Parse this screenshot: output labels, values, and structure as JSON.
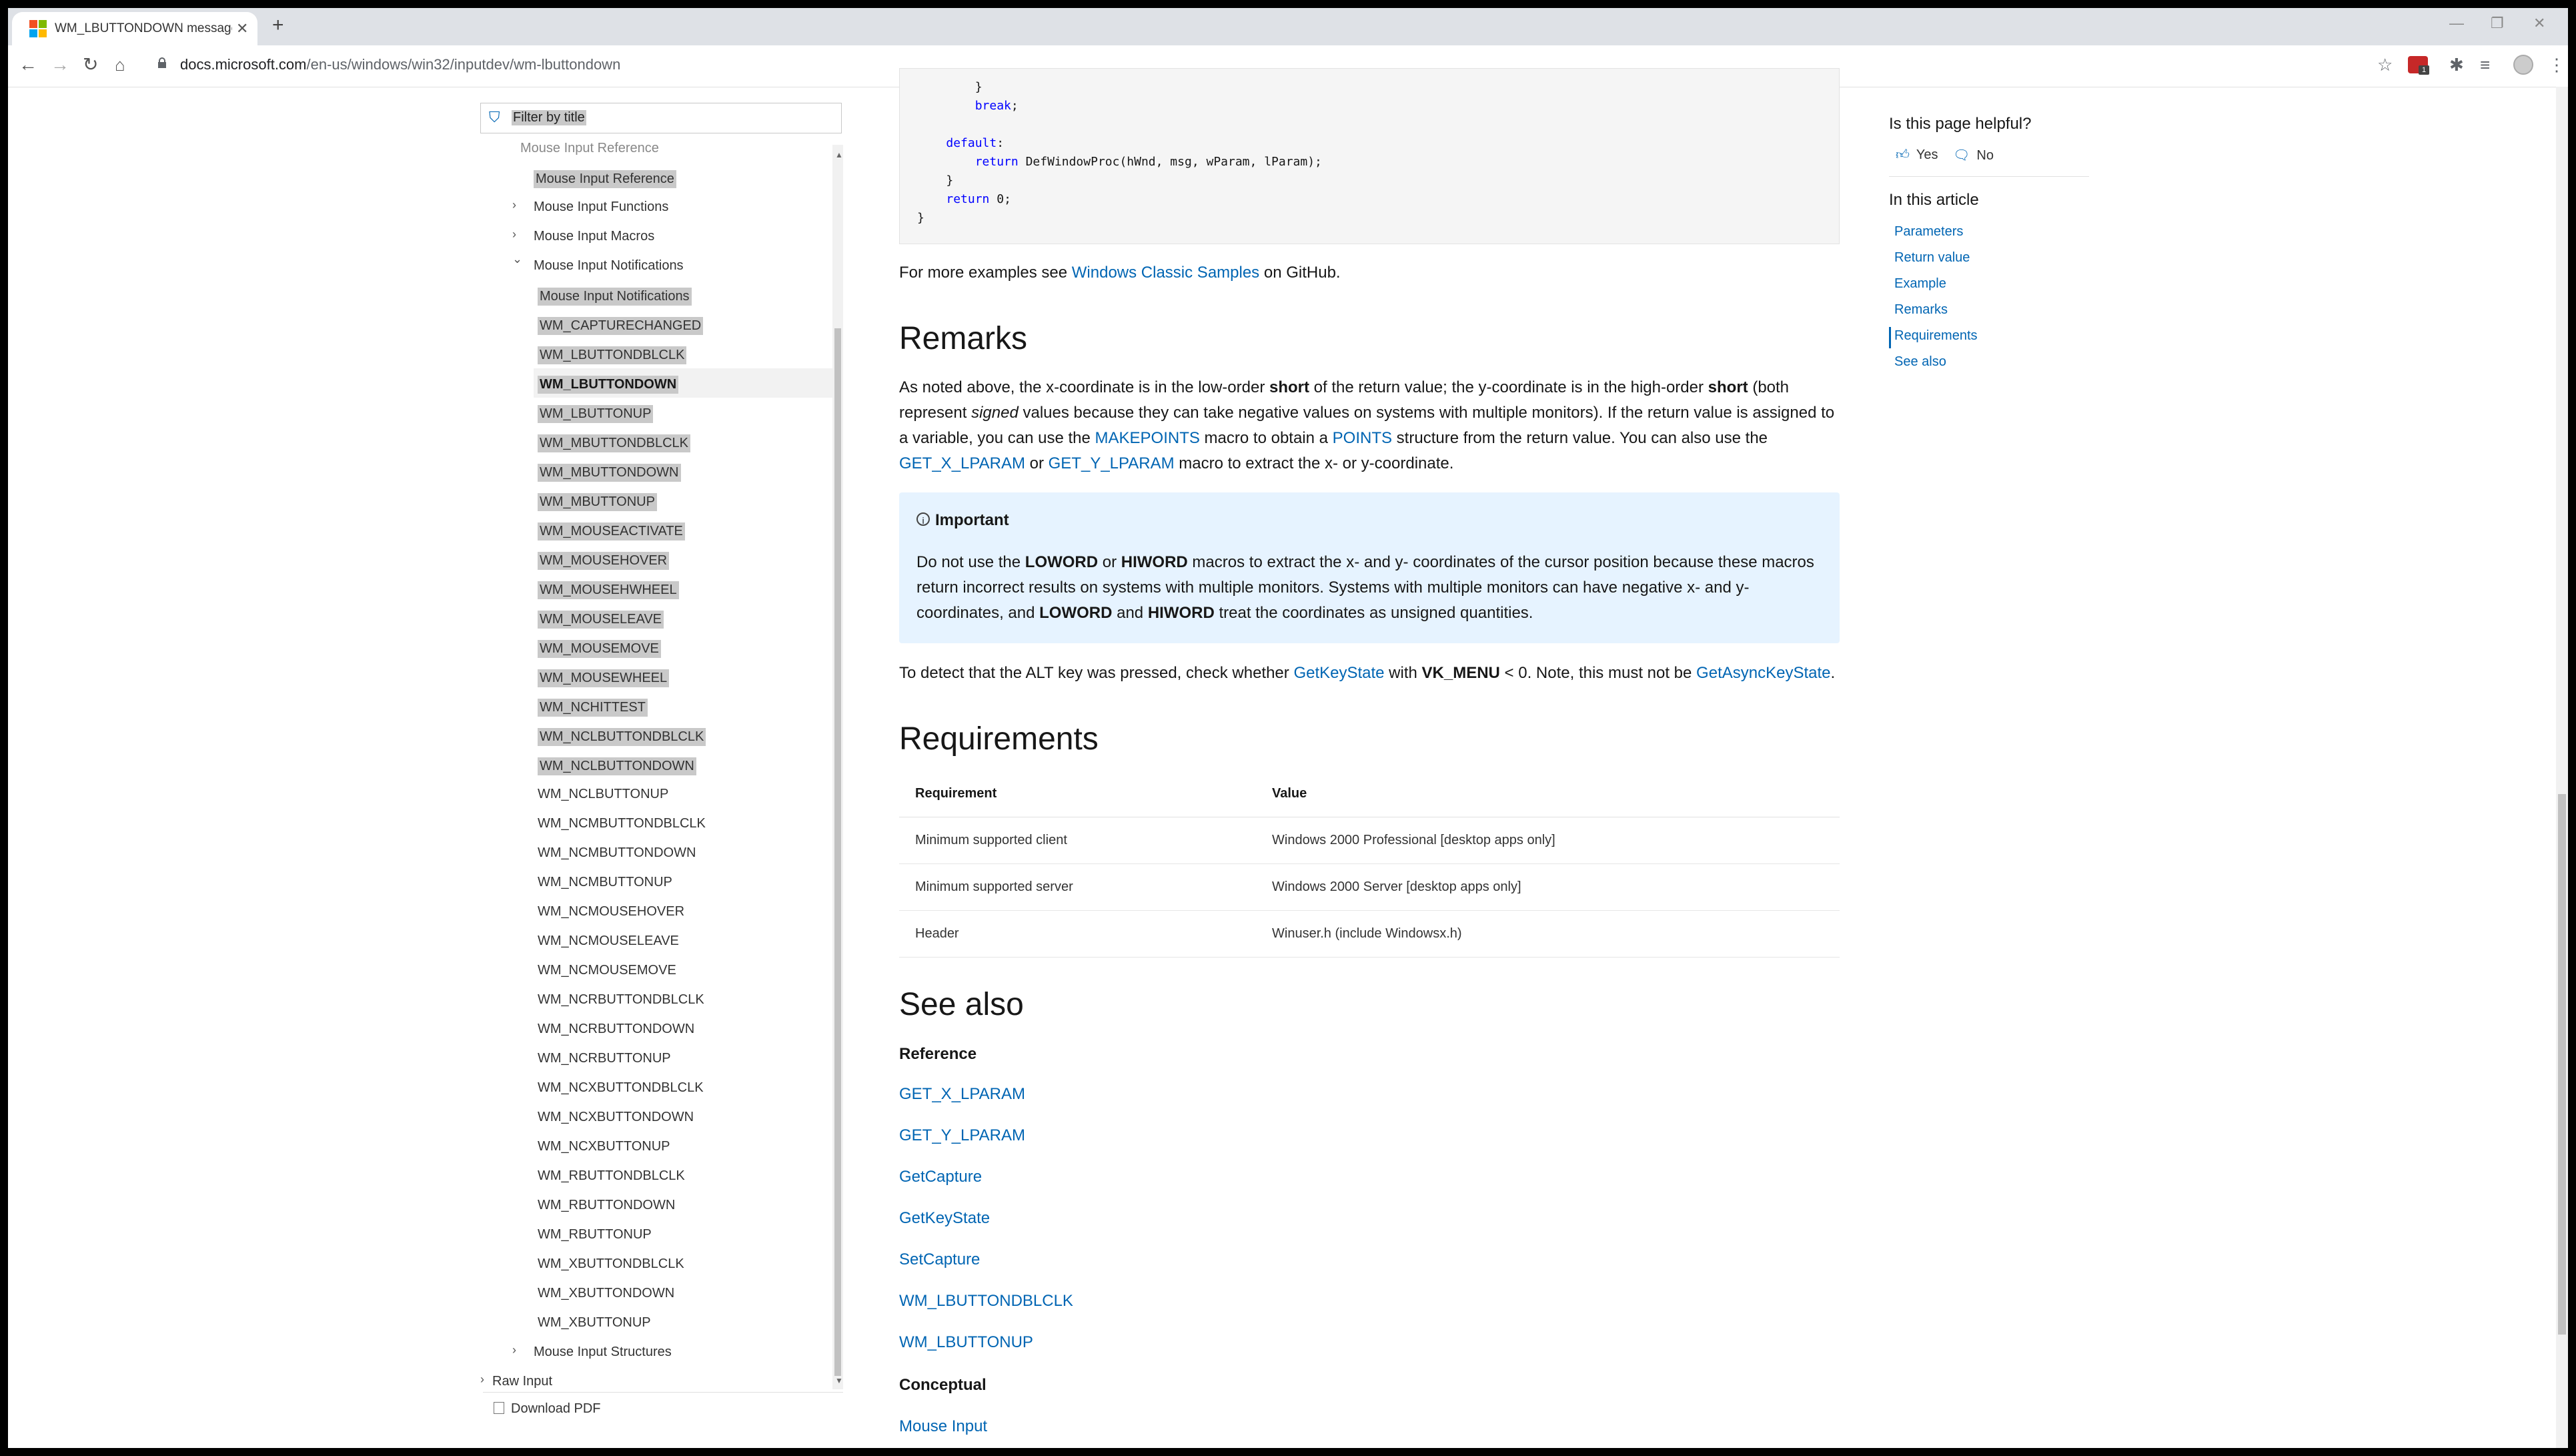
{
  "browser": {
    "tab_title": "WM_LBUTTONDOWN message (",
    "tab_close": "✕",
    "new_tab": "+",
    "url_host": "docs.microsoft.com",
    "url_path": "/en-us/windows/win32/inputdev/wm-lbuttondown",
    "extension_badge": "1",
    "window_controls": [
      "—",
      "❐",
      "✕"
    ]
  },
  "nav": {
    "filter_placeholder": "Filter by title",
    "partial_heading": "Mouse Input Reference",
    "items": [
      {
        "label": "Mouse Input Reference",
        "level": 1,
        "hl": true
      },
      {
        "label": "Mouse Input Functions",
        "level": 1,
        "chevron": "›"
      },
      {
        "label": "Mouse Input Macros",
        "level": 1,
        "chevron": "›"
      },
      {
        "label": "Mouse Input Notifications",
        "level": 1,
        "chevron": "⌄"
      },
      {
        "label": "Mouse Input Notifications",
        "level": 2,
        "hl": true
      },
      {
        "label": "WM_CAPTURECHANGED",
        "level": 2,
        "hl": true
      },
      {
        "label": "WM_LBUTTONDBLCLK",
        "level": 2,
        "hl": true
      },
      {
        "label": "WM_LBUTTONDOWN",
        "level": 2,
        "hl": true,
        "current": true
      },
      {
        "label": "WM_LBUTTONUP",
        "level": 2,
        "hl": true
      },
      {
        "label": "WM_MBUTTONDBLCLK",
        "level": 2,
        "hl": true
      },
      {
        "label": "WM_MBUTTONDOWN",
        "level": 2,
        "hl": true
      },
      {
        "label": "WM_MBUTTONUP",
        "level": 2,
        "hl": true
      },
      {
        "label": "WM_MOUSEACTIVATE",
        "level": 2,
        "hl": true
      },
      {
        "label": "WM_MOUSEHOVER",
        "level": 2,
        "hl": true
      },
      {
        "label": "WM_MOUSEHWHEEL",
        "level": 2,
        "hl": true
      },
      {
        "label": "WM_MOUSELEAVE",
        "level": 2,
        "hl": true
      },
      {
        "label": "WM_MOUSEMOVE",
        "level": 2,
        "hl": true
      },
      {
        "label": "WM_MOUSEWHEEL",
        "level": 2,
        "hl": true
      },
      {
        "label": "WM_NCHITTEST",
        "level": 2,
        "hl": true
      },
      {
        "label": "WM_NCLBUTTONDBLCLK",
        "level": 2,
        "hl": true
      },
      {
        "label": "WM_NCLBUTTONDOWN",
        "level": 2,
        "hl": true
      },
      {
        "label": "WM_NCLBUTTONUP",
        "level": 2
      },
      {
        "label": "WM_NCMBUTTONDBLCLK",
        "level": 2
      },
      {
        "label": "WM_NCMBUTTONDOWN",
        "level": 2
      },
      {
        "label": "WM_NCMBUTTONUP",
        "level": 2
      },
      {
        "label": "WM_NCMOUSEHOVER",
        "level": 2
      },
      {
        "label": "WM_NCMOUSELEAVE",
        "level": 2
      },
      {
        "label": "WM_NCMOUSEMOVE",
        "level": 2
      },
      {
        "label": "WM_NCRBUTTONDBLCLK",
        "level": 2
      },
      {
        "label": "WM_NCRBUTTONDOWN",
        "level": 2
      },
      {
        "label": "WM_NCRBUTTONUP",
        "level": 2
      },
      {
        "label": "WM_NCXBUTTONDBLCLK",
        "level": 2
      },
      {
        "label": "WM_NCXBUTTONDOWN",
        "level": 2
      },
      {
        "label": "WM_NCXBUTTONUP",
        "level": 2
      },
      {
        "label": "WM_RBUTTONDBLCLK",
        "level": 2
      },
      {
        "label": "WM_RBUTTONDOWN",
        "level": 2
      },
      {
        "label": "WM_RBUTTONUP",
        "level": 2
      },
      {
        "label": "WM_XBUTTONDBLCLK",
        "level": 2
      },
      {
        "label": "WM_XBUTTONDOWN",
        "level": 2
      },
      {
        "label": "WM_XBUTTONUP",
        "level": 2
      },
      {
        "label": "Mouse Input Structures",
        "level": 1,
        "chevron": "›"
      },
      {
        "label": "Raw Input",
        "level": 0,
        "chevron": "›"
      }
    ],
    "download_pdf": "Download PDF"
  },
  "main": {
    "code_lines": [
      {
        "text": "        }",
        "kw": ""
      },
      {
        "text": "        break;",
        "kw": "break"
      },
      {
        "text": "",
        "kw": ""
      },
      {
        "text": "    default:",
        "kw": "default"
      },
      {
        "text": "        return DefWindowProc(hWnd, msg, wParam, lParam);",
        "kw": "return"
      },
      {
        "text": "    }",
        "kw": ""
      },
      {
        "text": "    return 0;",
        "kw": "return"
      },
      {
        "text": "}",
        "kw": ""
      }
    ],
    "more_examples_prefix": "For more examples see ",
    "more_examples_link": "Windows Classic Samples",
    "more_examples_suffix": " on GitHub.",
    "remarks_heading": "Remarks",
    "remarks_p1": {
      "t1": "As noted above, the x-coordinate is in the low-order ",
      "b1": "short",
      "t2": " of the return value; the y-coordinate is in the high-order ",
      "b2": "short",
      "t3": " (both represent ",
      "i1": "signed",
      "t4": " values because they can take negative values on systems with multiple monitors). If the return value is assigned to a variable, you can use the ",
      "l1": "MAKEPOINTS",
      "t5": " macro to obtain a ",
      "l2": "POINTS",
      "t6": " structure from the return value. You can also use the ",
      "l3": "GET_X_LPARAM",
      "t7": " or ",
      "l4": "GET_Y_LPARAM",
      "t8": " macro to extract the x- or y-coordinate."
    },
    "important": {
      "icon": "i",
      "title": "Important",
      "t1": "Do not use the ",
      "b1": "LOWORD",
      "t2": " or ",
      "b2": "HIWORD",
      "t3": " macros to extract the x- and y- coordinates of the cursor position because these macros return incorrect results on systems with multiple monitors. Systems with multiple monitors can have negative x- and y- coordinates, and ",
      "b3": "LOWORD",
      "t4": " and ",
      "b4": "HIWORD",
      "t5": " treat the coordinates as unsigned quantities."
    },
    "alt_para": {
      "t1": "To detect that the ALT key was pressed, check whether ",
      "l1": "GetKeyState",
      "t2": " with ",
      "b1": "VK_MENU",
      "t3": " < 0. Note, this must not be ",
      "l2": "GetAsyncKeyState",
      "t4": "."
    },
    "requirements_heading": "Requirements",
    "req_headers": [
      "Requirement",
      "Value"
    ],
    "req_rows": [
      [
        "Minimum supported client",
        "Windows 2000 Professional [desktop apps only]"
      ],
      [
        "Minimum supported server",
        "Windows 2000 Server [desktop apps only]"
      ],
      [
        "Header",
        "Winuser.h (include Windowsx.h)"
      ]
    ],
    "see_also_heading": "See also",
    "reference_label": "Reference",
    "reference_links": [
      "GET_X_LPARAM",
      "GET_Y_LPARAM",
      "GetCapture",
      "GetKeyState",
      "SetCapture",
      "WM_LBUTTONDBLCLK",
      "WM_LBUTTONUP"
    ],
    "conceptual_label": "Conceptual",
    "conceptual_links": [
      "Mouse Input"
    ]
  },
  "aside": {
    "helpful_question": "Is this page helpful?",
    "yes": "Yes",
    "no": "No",
    "in_this_article": "In this article",
    "toc": [
      "Parameters",
      "Return value",
      "Example",
      "Remarks",
      "Requirements",
      "See also"
    ],
    "toc_active": "Requirements"
  },
  "colors": {
    "link": "#0065b3",
    "highlight": "#c9c9c9",
    "note_bg": "#e6f3ff"
  }
}
